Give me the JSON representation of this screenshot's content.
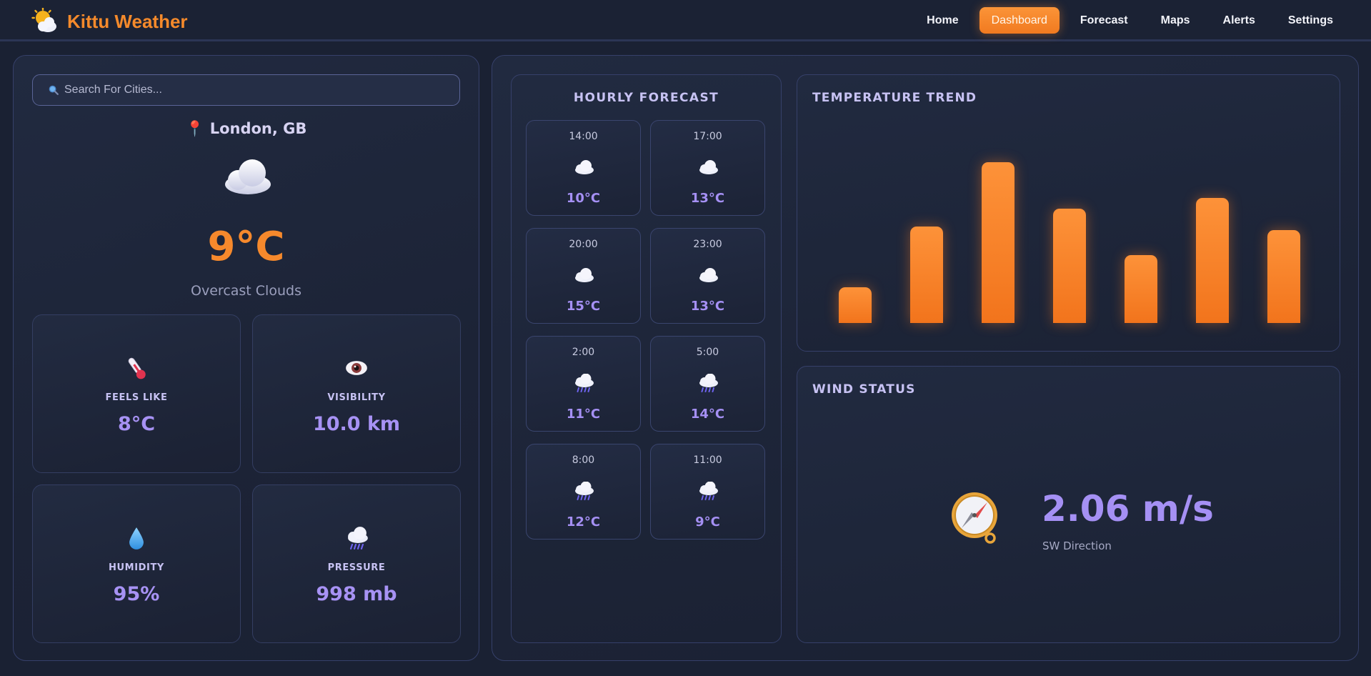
{
  "header": {
    "app_name": "Kittu Weather",
    "logo_icon": "sun-cloud-icon",
    "nav": [
      {
        "label": "Home",
        "active": false
      },
      {
        "label": "Dashboard",
        "active": true
      },
      {
        "label": "Forecast",
        "active": false
      },
      {
        "label": "Maps",
        "active": false
      },
      {
        "label": "Alerts",
        "active": false
      },
      {
        "label": "Settings",
        "active": false
      }
    ]
  },
  "current": {
    "search_placeholder": "Search For Cities...",
    "location": "London, GB",
    "icon": "cloud-icon",
    "temperature": "9°C",
    "description": "Overcast Clouds",
    "stats": [
      {
        "label": "FEELS LIKE",
        "value": "8°C",
        "icon": "thermometer-icon"
      },
      {
        "label": "VISIBILITY",
        "value": "10.0 km",
        "icon": "eye-icon"
      },
      {
        "label": "HUMIDITY",
        "value": "95%",
        "icon": "droplet-icon"
      },
      {
        "label": "PRESSURE",
        "value": "998 mb",
        "icon": "rain-cloud-icon"
      }
    ]
  },
  "hourly": {
    "title": "HOURLY FORECAST",
    "items": [
      {
        "time": "14:00",
        "temp": "10°C",
        "icon": "cloud-icon"
      },
      {
        "time": "17:00",
        "temp": "13°C",
        "icon": "cloud-icon"
      },
      {
        "time": "20:00",
        "temp": "15°C",
        "icon": "cloud-icon"
      },
      {
        "time": "23:00",
        "temp": "13°C",
        "icon": "cloud-icon"
      },
      {
        "time": "2:00",
        "temp": "11°C",
        "icon": "rain-cloud-icon"
      },
      {
        "time": "5:00",
        "temp": "14°C",
        "icon": "rain-cloud-icon"
      },
      {
        "time": "8:00",
        "temp": "12°C",
        "icon": "rain-cloud-icon"
      },
      {
        "time": "11:00",
        "temp": "9°C",
        "icon": "rain-cloud-icon"
      }
    ]
  },
  "trend": {
    "title": "TEMPERATURE TREND"
  },
  "wind": {
    "title": "WIND STATUS",
    "speed": "2.06 m/s",
    "direction": "SW Direction",
    "icon": "compass-icon"
  },
  "colors": {
    "accent": "#f58a2b",
    "value_purple": "#a590f4",
    "background": "#1a2133"
  },
  "chart_data": {
    "type": "bar",
    "categories": [
      "",
      "",
      "",
      "",
      "",
      "",
      ""
    ],
    "values": [
      10,
      27,
      45,
      32,
      19,
      35,
      26
    ],
    "ylim": [
      0,
      50
    ],
    "title": "",
    "grid": false
  }
}
